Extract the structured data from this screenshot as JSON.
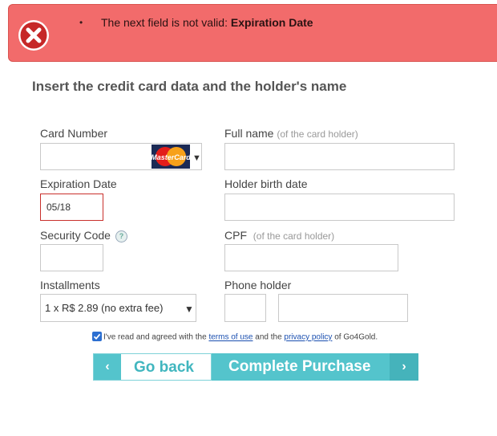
{
  "error": {
    "bullet": "•",
    "message": "The next field is not valid: ",
    "field": "Expiration Date"
  },
  "title": "Insert the credit card data and the holder's name",
  "fields": {
    "card_number": {
      "label": "Card Number",
      "value": "",
      "card_brand": "MasterCard"
    },
    "full_name": {
      "label": "Full name",
      "hint": "(of the card holder)",
      "value": ""
    },
    "expiration": {
      "label": "Expiration Date",
      "value": "05/18"
    },
    "birth_date": {
      "label": "Holder birth date",
      "value": ""
    },
    "security_code": {
      "label": "Security Code",
      "help": "?",
      "value": ""
    },
    "cpf": {
      "label": "CPF",
      "hint": "(of the card holder)",
      "value": ""
    },
    "installments": {
      "label": "Installments",
      "selected": "1 x R$ 2.89 (no extra fee)"
    },
    "phone": {
      "label": "Phone holder",
      "area": "",
      "number": ""
    }
  },
  "agreement": {
    "checked": true,
    "prefix": "I've read and agreed with the ",
    "terms": "terms of use",
    "middle": " and the ",
    "privacy": "privacy policy",
    "suffix": " of Go4Gold."
  },
  "buttons": {
    "back_label": "Go back",
    "back_arrow": "‹",
    "complete_label": "Complete Purchase",
    "complete_arrow": "›"
  },
  "colors": {
    "error_bg": "#f26b6b",
    "accent": "#54c4cc",
    "invalid_border": "#c9302c"
  }
}
